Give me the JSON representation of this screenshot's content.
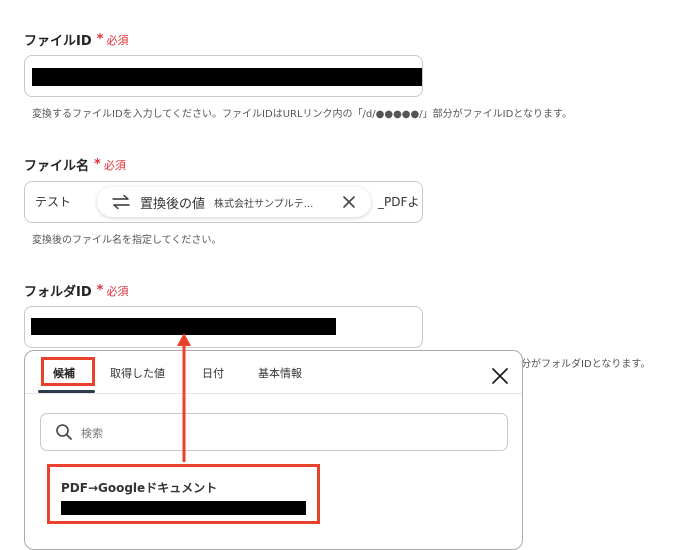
{
  "file_id": {
    "label": "ファイルID",
    "required_mark": "*",
    "required_text": "必須",
    "help": "変換するファイルIDを入力してください。ファイルIDはURLリンク内の「/d/●●●●●/」部分がファイルIDとなります。"
  },
  "file_name": {
    "label": "ファイル名",
    "required_mark": "*",
    "required_text": "必須",
    "prefix_text": "テスト",
    "chip_label": "置換後の値",
    "chip_value": "株式会社サンプルテ...",
    "suffix_text": "_PDFよ",
    "help": "変換後のファイル名を指定してください。"
  },
  "folder_id": {
    "label": "フォルダID",
    "required_mark": "*",
    "required_text": "必須",
    "help_tail": "分がフォルダIDとなります。"
  },
  "popup": {
    "tabs": [
      "候補",
      "取得した値",
      "日付",
      "基本情報"
    ],
    "search_placeholder": "検索",
    "candidate_title": "PDF→Googleドキュメント"
  },
  "colors": {
    "required": "#e0303a",
    "highlight": "#e8412c",
    "tab_underline": "#2e3a4c"
  },
  "icons": [
    "swap-arrows-icon",
    "close-icon",
    "search-icon",
    "arrow-up-icon"
  ]
}
